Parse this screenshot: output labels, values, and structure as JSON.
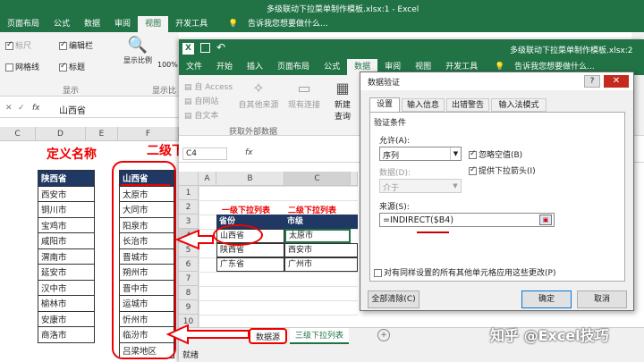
{
  "back_window": {
    "title": "多级联动下拉菜单制作模板.xlsx:1 - Excel",
    "tabs": [
      "页面布局",
      "公式",
      "数据",
      "审阅",
      "视图",
      "开发工具"
    ],
    "tell_me": "告诉我您想要做什么...",
    "ribbon": {
      "ruler": "标尺",
      "formula_bar": "编辑栏",
      "gridlines": "网格线",
      "headings": "标题",
      "zoom_label": "显示比例",
      "zoom_pct": "100%",
      "group_show": "显示",
      "group_zoom": "显示比"
    },
    "name_box": "",
    "formula_value": "山西省",
    "fx": "fx",
    "col_headers": [
      "C",
      "D",
      "E",
      "F"
    ],
    "annotation_define_name": "定义名称",
    "annotation_level2": "二级下",
    "table1": {
      "header": "陕西省",
      "items": [
        "西安市",
        "铜川市",
        "宝鸡市",
        "咸阳市",
        "渭南市",
        "延安市",
        "汉中市",
        "榆林市",
        "安康市",
        "商洛市"
      ]
    },
    "table2": {
      "header": "山西省",
      "items": [
        "太原市",
        "大同市",
        "阳泉市",
        "长治市",
        "晋城市",
        "朔州市",
        "晋中市",
        "运城市",
        "忻州市",
        "临汾市",
        "吕梁地区"
      ]
    }
  },
  "front_window": {
    "title": "多级联动下拉菜单制作模板.xlsx:2",
    "tabs": [
      "文件",
      "开始",
      "插入",
      "页面布局",
      "公式",
      "数据",
      "审阅",
      "视图",
      "开发工具"
    ],
    "tell_me": "告诉我您想要做什么...",
    "ribbon": {
      "from_access": "自 Access",
      "from_web": "自网站",
      "from_text": "自文本",
      "other_sources": "自其他来源",
      "existing_conn": "现有连接",
      "new_query": "新建",
      "new_query2": "查询",
      "get_external": "获取外部数据"
    },
    "name_box": "C4",
    "fx": "fx",
    "col_headers": [
      "A",
      "B",
      "C"
    ],
    "row_headers": [
      "1",
      "2",
      "3",
      "4",
      "5",
      "6",
      "7",
      "8",
      "9",
      "10"
    ],
    "cells": {
      "b2": "一级下拉列表",
      "c2": "二级下拉列表",
      "b3": "省份",
      "c3": "市级",
      "b4": "山西省",
      "c4": "太原市",
      "b5": "陕西省",
      "c5": "西安市",
      "b6": "广东省",
      "c6": "广州市"
    },
    "sheet_tabs": [
      "数据源",
      "三级下拉列表"
    ],
    "status": "就绪"
  },
  "dialog": {
    "title": "数据验证",
    "help": "?",
    "tabs": [
      "设置",
      "输入信息",
      "出错警告",
      "输入法模式"
    ],
    "section": "验证条件",
    "allow_label": "允许(A):",
    "allow_value": "序列",
    "data_label": "数据(D):",
    "data_value": "介于",
    "ignore_blank": "忽略空值(B)",
    "in_cell_dropdown": "提供下拉箭头(I)",
    "source_label": "来源(S):",
    "source_value": "=INDIRECT($B4)",
    "apply_all": "对有同样设置的所有其他单元格应用这些更改(P)",
    "clear_all": "全部清除(C)",
    "ok": "确定",
    "cancel": "取消"
  },
  "watermark": "知乎 @Excel技巧",
  "colors": {
    "excel_green": "#217346",
    "header_navy": "#1f3864",
    "annotation_red": "#e00000",
    "source_red": "#c00000"
  }
}
